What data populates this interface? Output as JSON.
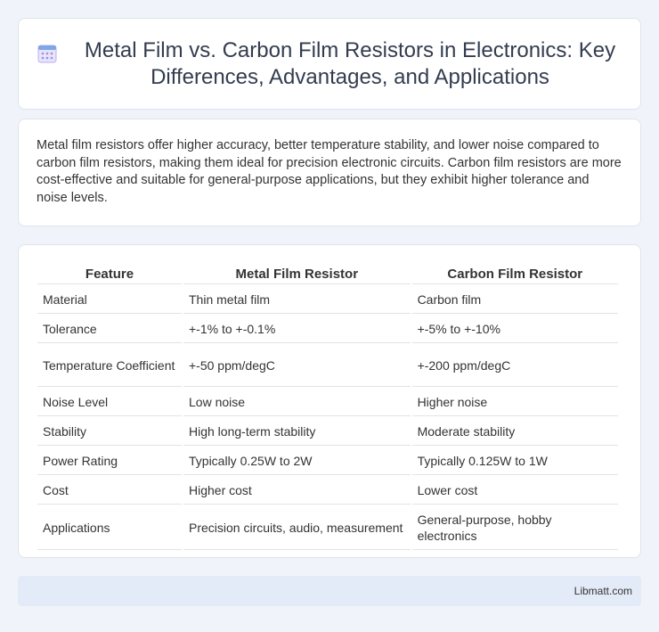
{
  "header": {
    "icon": "calendar-grid-icon",
    "title": "Metal Film vs. Carbon Film Resistors in Electronics: Key Differences, Advantages, and Applications"
  },
  "summary": "Metal film resistors offer higher accuracy, better temperature stability, and lower noise compared to carbon film resistors, making them ideal for precision electronic circuits. Carbon film resistors are more cost-effective and suitable for general-purpose applications, but they exhibit higher tolerance and noise levels.",
  "table": {
    "headers": [
      "Feature",
      "Metal Film Resistor",
      "Carbon Film Resistor"
    ],
    "rows": [
      [
        "Material",
        "Thin metal film",
        "Carbon film"
      ],
      [
        "Tolerance",
        "+-1% to +-0.1%",
        "+-5% to +-10%"
      ],
      [
        "Temperature Coefficient",
        "+-50 ppm/degC",
        "+-200 ppm/degC"
      ],
      [
        "Noise Level",
        "Low noise",
        "Higher noise"
      ],
      [
        "Stability",
        "High long-term stability",
        "Moderate stability"
      ],
      [
        "Power Rating",
        "Typically 0.25W to 2W",
        "Typically 0.125W to 1W"
      ],
      [
        "Cost",
        "Higher cost",
        "Lower cost"
      ],
      [
        "Applications",
        "Precision circuits, audio, measurement",
        "General-purpose, hobby electronics"
      ]
    ]
  },
  "footer": {
    "brand": "Libmatt.com"
  },
  "colors": {
    "background": "#f0f4fa",
    "card": "#ffffff",
    "footer": "#e4ebf8",
    "icon_accent": "#8a7ee0"
  }
}
